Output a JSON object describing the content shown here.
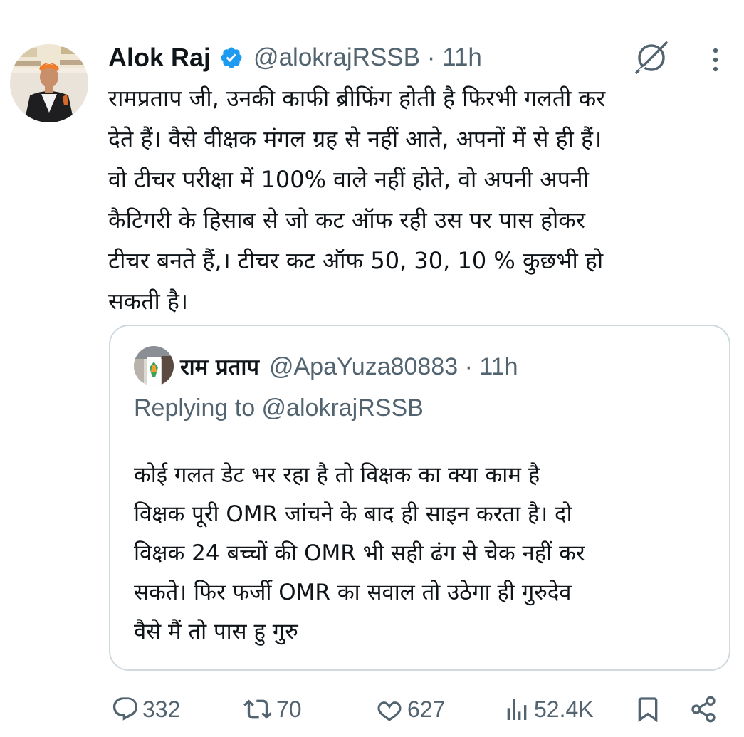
{
  "colors": {
    "verified_blue": "#1d9bf0",
    "secondary_text": "#536471",
    "primary_text": "#0f1419",
    "card_border": "#cfd9de"
  },
  "tweet": {
    "author": {
      "name": "Alok Raj",
      "handle": "@alokrajRSSB",
      "verified": true,
      "avatar_icon": "profile-photo"
    },
    "handle_time": "@alokrajRSSB · 11h",
    "time": "11h",
    "text": "रामप्रताप जी, उनकी काफी ब्रीफिंग होती है फिरभी गलती कर\nदेते हैं। वैसे वीक्षक मंगल ग्रह से नहीं आते, अपनों में से ही हैं।\nवो टीचर परीक्षा में 100% वाले नहीं होते, वो अपनी अपनी\nकैटिगरी के हिसाब से जो कट ऑफ रही उस पर पास होकर\nटीचर बनते हैं,। टीचर कट ऑफ 50, 30, 10 % कुछभी हो\nसकती है।"
  },
  "quoted": {
    "name": "राम प्रताप",
    "handle": "@ApaYuza80883",
    "handle_time": "@ApaYuza80883 · 11h",
    "replying": "Replying to @alokrajRSSB",
    "text": "कोई गलत डेट भर रहा है तो विक्षक का क्या काम है\nविक्षक पूरी OMR जांचने के बाद ही साइन करता है। दो\nविक्षक  24 बच्चों की OMR भी सही ढंग से चेक नहीं कर\nसकते। फिर फर्जी OMR का सवाल तो उठेगा ही गुरुदेव\nवैसे मैं तो पास हु गुरु"
  },
  "actions": {
    "replies": "332",
    "reposts": "70",
    "likes": "627",
    "views": "52.4K"
  }
}
